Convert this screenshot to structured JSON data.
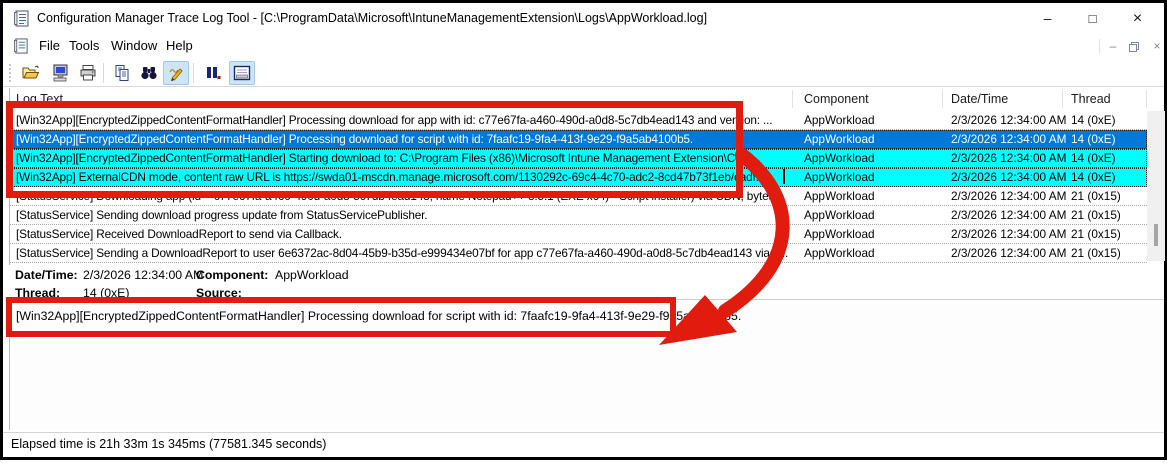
{
  "window": {
    "title": "Configuration Manager Trace Log Tool - [C:\\ProgramData\\Microsoft\\IntuneManagementExtension\\Logs\\AppWorkload.log]",
    "controls": {
      "minimize": "–",
      "maximize": "□",
      "close": "×"
    },
    "mdi_controls": {
      "minimize": "–",
      "close": "×"
    }
  },
  "menu": {
    "items": [
      {
        "label": "File"
      },
      {
        "label": "Tools"
      },
      {
        "label": "Window"
      },
      {
        "label": "Help"
      }
    ]
  },
  "toolbar": {
    "buttons": [
      {
        "name": "open-file",
        "icon": "open-folder-icon",
        "pressed": false
      },
      {
        "name": "connect-computer",
        "icon": "computer-icon",
        "pressed": false
      },
      {
        "name": "print",
        "icon": "printer-icon",
        "pressed": false
      },
      {
        "name": "copy",
        "icon": "copy-icon",
        "pressed": false
      },
      {
        "name": "find",
        "icon": "binoculars-icon",
        "pressed": false
      },
      {
        "name": "highlight",
        "icon": "highlighter-icon",
        "pressed": true
      },
      {
        "name": "pause",
        "icon": "pause-icon",
        "pressed": false
      },
      {
        "name": "show-detail-pane",
        "icon": "detail-view-icon",
        "pressed": true
      }
    ]
  },
  "log_table": {
    "columns": [
      "Log Text",
      "Component",
      "Date/Time",
      "Thread"
    ],
    "rows": [
      {
        "text": "[Win32App][EncryptedZippedContentFormatHandler] Processing download for app with id: c77e67fa-a460-490d-a0d8-5c7db4ead143 and version: ...",
        "component": "AppWorkload",
        "datetime": "2/3/2026 12:34:00 AM",
        "thread": "14 (0xE)",
        "highlight": "none"
      },
      {
        "text": "[Win32App][EncryptedZippedContentFormatHandler] Processing download for script with id: 7faafc19-9fa4-413f-9e29-f9a5ab4100b5.",
        "component": "AppWorkload",
        "datetime": "2/3/2026 12:34:00 AM",
        "thread": "14 (0xE)",
        "highlight": "selected"
      },
      {
        "text": "[Win32App][EncryptedZippedContentFormatHandler] Starting download to: C:\\Program Files (x86)\\Microsoft Intune Management Extension\\Cont...",
        "component": "AppWorkload",
        "datetime": "2/3/2026 12:34:00 AM",
        "thread": "14 (0xE)",
        "highlight": "cyan"
      },
      {
        "text": "[Win32App] ExternalCDN mode, content raw URL is https://swda01-mscdn.manage.microsoft.com/1130292c-69c4-4c70-adc2-8cd47b73f1eb/cadf...",
        "component": "AppWorkload",
        "datetime": "2/3/2026 12:34:00 AM",
        "thread": "14 (0xE)",
        "highlight": "cyan"
      },
      {
        "text": "[StatusService] Downloading app (id = c77e67fa-a460-490d-a0d8-5c7db4ead143, name Notepad++ 8.5.1 (EXE x64) - Script installer) via CDN, bytes...",
        "component": "AppWorkload",
        "datetime": "2/3/2026 12:34:00 AM",
        "thread": "21 (0x15)",
        "highlight": "none"
      },
      {
        "text": "[StatusService] Sending download progress update from StatusServicePublisher.",
        "component": "AppWorkload",
        "datetime": "2/3/2026 12:34:00 AM",
        "thread": "21 (0x15)",
        "highlight": "none"
      },
      {
        "text": "[StatusService] Received DownloadReport to send via Callback.",
        "component": "AppWorkload",
        "datetime": "2/3/2026 12:34:00 AM",
        "thread": "21 (0x15)",
        "highlight": "none"
      },
      {
        "text": "[StatusService] Sending a DownloadReport to user 6e6372ac-8d04-45b9-b35d-e999434e07bf for app c77e67fa-a460-490d-a0d8-5c7db4ead143 via c...",
        "component": "AppWorkload",
        "datetime": "2/3/2026 12:34:00 AM",
        "thread": "21 (0x15)",
        "highlight": "none"
      }
    ]
  },
  "detail_pane": {
    "fields": {
      "datetime_label": "Date/Time:",
      "datetime": "2/3/2026 12:34:00 AM",
      "component_label": "Component:",
      "component": "AppWorkload",
      "thread_label": "Thread:",
      "thread": "14 (0xE)",
      "source_label": "Source:",
      "source": ""
    },
    "text": "[Win32App][EncryptedZippedContentFormatHandler] Processing download for script with id: 7faafc19-9fa4-413f-9e29-f9a5ab4100b5."
  },
  "status_bar": {
    "text": "Elapsed time is 21h 33m 1s 345ms (77581.345 seconds)"
  },
  "colors": {
    "selection_blue": "#0078d7",
    "highlight_cyan": "#00ffff",
    "annotation_red": "#e11b0e"
  }
}
